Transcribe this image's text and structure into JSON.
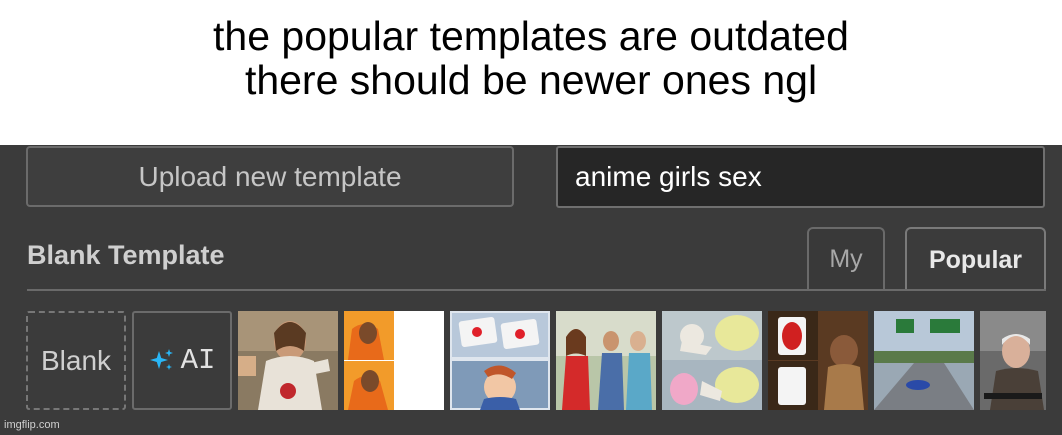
{
  "caption": {
    "line1": "the popular templates are outdated",
    "line2": "there should be newer ones ngl"
  },
  "toolbar": {
    "upload_label": "Upload new template",
    "search_value": "anime girls sex"
  },
  "section": {
    "title": "Blank Template",
    "tabs": [
      {
        "label": "My",
        "active": false
      },
      {
        "label": "Popular",
        "active": true
      }
    ]
  },
  "tiles": {
    "blank_label": "Blank",
    "ai_label": "AI",
    "ai_icon": "sparkles-icon",
    "thumbnails": [
      "buddy-christ-thumbnail",
      "drake-hotline-bling-thumbnail",
      "two-buttons-thumbnail",
      "distracted-boyfriend-thumbnail",
      "bike-fall-thumbnail",
      "uno-draw-25-thumbnail",
      "left-exit-12-off-ramp-thumbnail",
      "bernie-asking-thumbnail"
    ]
  },
  "watermark": "imgflip.com",
  "colors": {
    "panel_bg": "#3b3b3b",
    "input_bg": "#262626",
    "ai_icon": "#29b6f6"
  }
}
